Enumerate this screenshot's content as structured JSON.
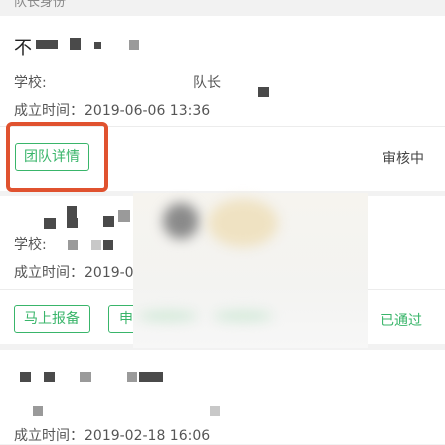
{
  "header": {
    "section_label": "队长身份"
  },
  "cards": [
    {
      "name_prefix": "不",
      "school_label": "学校:",
      "role": "队长",
      "founded_label": "成立时间：",
      "founded_time": "2019-06-06 13:36",
      "action_button": "团队详情",
      "status": "审核中"
    },
    {
      "school_label": "学校:",
      "founded_label": "成立时间：",
      "founded_time": "2019-0",
      "action_button": "马上报备",
      "second_button": "申",
      "status": "已通过"
    },
    {
      "founded_label": "成立时间：",
      "founded_time": "2019-02-18 16:06"
    }
  ],
  "colors": {
    "accent": "#39b56a",
    "highlight": "#e0522f"
  }
}
